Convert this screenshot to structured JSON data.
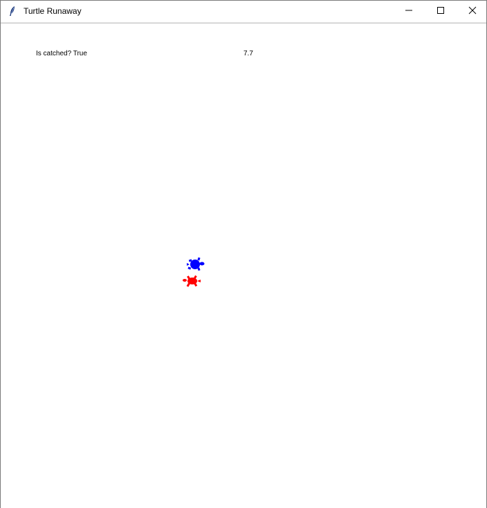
{
  "window": {
    "title": "Turtle Runaway",
    "app_icon": "feather-icon",
    "controls": {
      "minimize_icon": "minimize-icon",
      "maximize_icon": "maximize-icon",
      "close_icon": "close-icon"
    }
  },
  "canvas": {
    "status_text": "Is catched? True",
    "score_text": "7.7",
    "turtles": [
      {
        "name": "runner-turtle",
        "color": "#0000ff"
      },
      {
        "name": "chaser-turtle",
        "color": "#ff0000"
      }
    ]
  }
}
